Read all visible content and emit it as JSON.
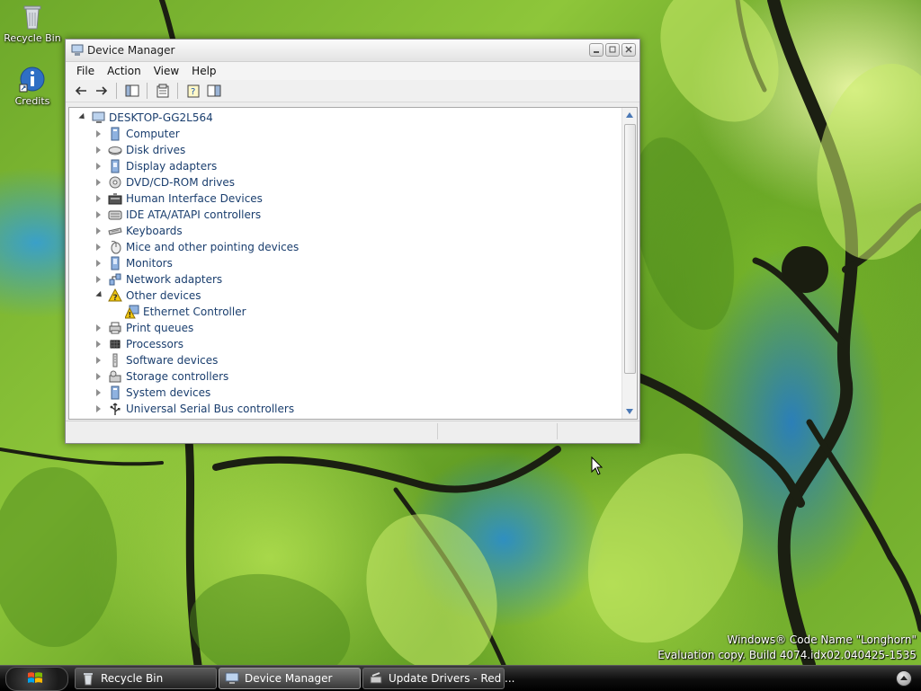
{
  "desktop": {
    "icons": [
      {
        "label": "Recycle Bin",
        "icon": "recycle-bin-icon"
      },
      {
        "label": "Credits",
        "icon": "info-icon"
      }
    ],
    "watermark": {
      "line1": "Windows® Code Name \"Longhorn\"",
      "line2": "Evaluation copy. Build 4074.idx02.040425-1535"
    }
  },
  "window": {
    "title": "Device Manager",
    "menu": [
      "File",
      "Action",
      "View",
      "Help"
    ],
    "toolbar": [
      "back-arrow-icon",
      "forward-arrow-icon",
      "show-hide-console-tree-icon",
      "properties-icon",
      "help-icon",
      "view-icon"
    ],
    "tree": {
      "root": "DESKTOP-GG2L564",
      "items": [
        {
          "label": "Computer",
          "icon": "computer-icon",
          "expanded": false
        },
        {
          "label": "Disk drives",
          "icon": "disk-drive-icon",
          "expanded": false
        },
        {
          "label": "Display adapters",
          "icon": "display-adapter-icon",
          "expanded": false
        },
        {
          "label": "DVD/CD-ROM drives",
          "icon": "dvd-drive-icon",
          "expanded": false
        },
        {
          "label": "Human Interface Devices",
          "icon": "hid-icon",
          "expanded": false
        },
        {
          "label": "IDE ATA/ATAPI controllers",
          "icon": "ide-controller-icon",
          "expanded": false
        },
        {
          "label": "Keyboards",
          "icon": "keyboard-icon",
          "expanded": false
        },
        {
          "label": "Mice and other pointing devices",
          "icon": "mouse-icon",
          "expanded": false
        },
        {
          "label": "Monitors",
          "icon": "monitor-icon",
          "expanded": false
        },
        {
          "label": "Network adapters",
          "icon": "network-adapter-icon",
          "expanded": false
        },
        {
          "label": "Other devices",
          "icon": "unknown-device-icon",
          "expanded": true,
          "children": [
            {
              "label": "Ethernet Controller",
              "icon": "warning-device-icon"
            }
          ]
        },
        {
          "label": "Print queues",
          "icon": "printer-icon",
          "expanded": false
        },
        {
          "label": "Processors",
          "icon": "processor-icon",
          "expanded": false
        },
        {
          "label": "Software devices",
          "icon": "software-device-icon",
          "expanded": false
        },
        {
          "label": "Storage controllers",
          "icon": "storage-controller-icon",
          "expanded": false
        },
        {
          "label": "System devices",
          "icon": "system-device-icon",
          "expanded": false
        },
        {
          "label": "Universal Serial Bus controllers",
          "icon": "usb-icon",
          "expanded": false
        }
      ]
    }
  },
  "taskbar": {
    "buttons": [
      {
        "label": "Recycle Bin",
        "icon": "recycle-bin-icon"
      },
      {
        "label": "Device Manager",
        "icon": "device-manager-icon"
      },
      {
        "label": "Update Drivers - Red ...",
        "icon": "update-drivers-icon"
      }
    ]
  },
  "colors": {
    "tree_text": "#1a3e6e",
    "warning": "#f2c811"
  }
}
